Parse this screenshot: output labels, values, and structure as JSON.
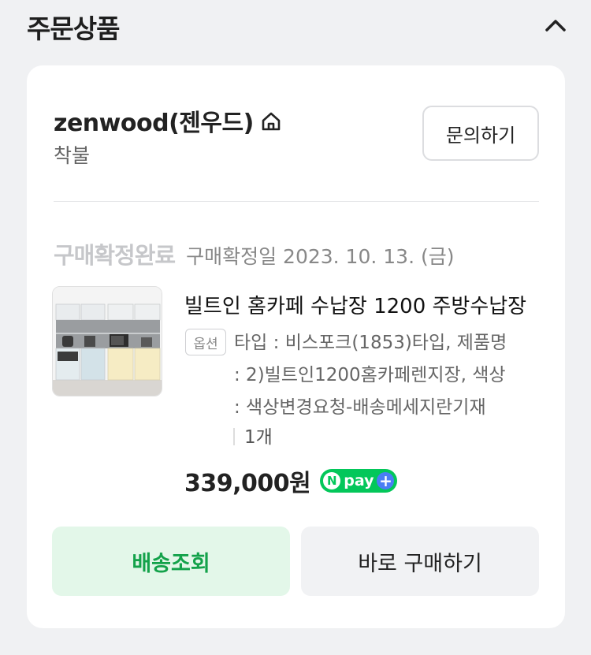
{
  "section": {
    "title": "주문상품",
    "collapse_icon": "chevron-up-icon"
  },
  "store": {
    "name": "zenwood(젠우드)",
    "home_icon": "home-icon",
    "shipping": "착불",
    "inquiry_label": "문의하기"
  },
  "order": {
    "status": "구매확정완료",
    "confirm_date": "구매확정일 2023. 10. 13. (금)"
  },
  "product": {
    "title": "빌트인 홈카페 수납장 1200 주방수납장",
    "option_badge": "옵션",
    "option_lines": [
      "타입 : 비스포크(1853)타입, 제품명",
      ": 2)빌트인1200홈카페렌지장, 색상",
      ": 색상변경요청-배송메세지란기재"
    ],
    "quantity": "1개",
    "price": "339,000원",
    "npay_n": "N",
    "npay_label": "pay",
    "npay_plus": "+"
  },
  "actions": {
    "tracking_label": "배송조회",
    "buy_again_label": "바로 구매하기"
  },
  "colors": {
    "page_bg": "#f0f1f3",
    "accent_green": "#13a24a",
    "npay_green": "#03c75a",
    "tracking_bg": "#e3f7e9"
  }
}
